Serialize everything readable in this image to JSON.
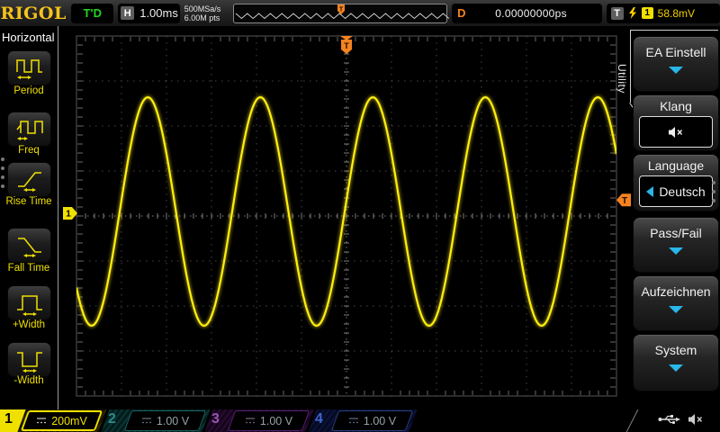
{
  "top_bar": {
    "logo": "RIGOL",
    "trigger_status": "T'D",
    "h_label": "H",
    "h_scale": "1.00ms",
    "sample_rate": "500MSa/s",
    "memory_depth": "6.00M pts",
    "d_label": "D",
    "d_value": "0.00000000ps",
    "t_label": "T",
    "trigger_source_channel": "1",
    "trigger_level_readout": "58.8mV"
  },
  "left_menu": {
    "title": "Horizontal",
    "items": [
      {
        "label": "Period"
      },
      {
        "label": "Freq"
      },
      {
        "label": "Rise Time"
      },
      {
        "label": "Fall Time"
      },
      {
        "label": "+Width"
      },
      {
        "label": "-Width"
      }
    ]
  },
  "right_menu": {
    "tab_title": "Utility",
    "items": [
      {
        "label": "EA Einstell",
        "type": "dropdown"
      },
      {
        "label": "Klang",
        "type": "icon-box",
        "icon": "speaker-muted-icon"
      },
      {
        "label": "Language",
        "type": "select",
        "value": "Deutsch"
      },
      {
        "label": "Pass/Fail",
        "type": "dropdown"
      },
      {
        "label": "Aufzeichnen",
        "type": "dropdown"
      },
      {
        "label": "System",
        "type": "dropdown"
      }
    ]
  },
  "channels": [
    {
      "id": "1",
      "value": "200mV",
      "active": true
    },
    {
      "id": "2",
      "value": "1.00 V",
      "active": false
    },
    {
      "id": "3",
      "value": "1.00 V",
      "active": false
    },
    {
      "id": "4",
      "value": "1.00 V",
      "active": false
    }
  ],
  "colors": {
    "accent_yellow": "#f0e000",
    "wave_yellow": "#ffee10",
    "trigger_orange": "#f5821f",
    "menu_cyan": "#29b6e8",
    "triggered_green": "#22d422",
    "grid_line": "#464646",
    "grid_center": "#7d7d7d"
  },
  "chart_data": {
    "type": "line",
    "waveform": "sine",
    "source_channel": "CH1",
    "title": "",
    "x_scale_per_div": "1.00ms",
    "y_scale_per_div": "200mV",
    "h_divs": 12,
    "v_divs": 8,
    "period_divs": 2.5,
    "period_ms": 2.5,
    "frequency_hz": 400,
    "amplitude_divs": 2.54,
    "amplitude_mv": 508,
    "cycles_visible": 4.8,
    "ground_y_div_from_top": 3.94,
    "rising_zero_x_div": 0.96,
    "trigger_pos_x_div": 6,
    "trigger_level_mv": 58.8,
    "mv_per_div": 200,
    "grid_on": true
  }
}
